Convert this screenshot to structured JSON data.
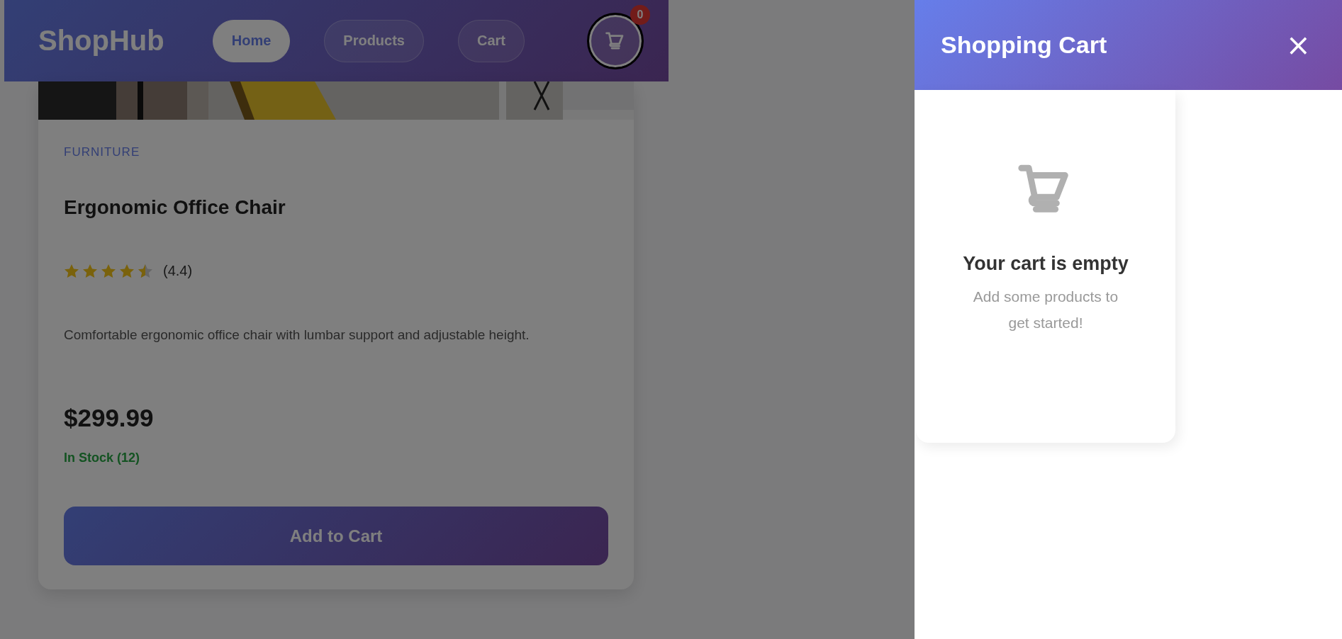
{
  "header": {
    "logo": "ShopHub",
    "nav": [
      {
        "label": "Home",
        "selected": true
      },
      {
        "label": "Products",
        "selected": false
      },
      {
        "label": "Cart",
        "selected": false
      }
    ],
    "cart_count": "0"
  },
  "product": {
    "category": "FURNITURE",
    "name": "Ergonomic Office Chair",
    "stars": 4.5,
    "rating": "(4.4)",
    "description": "Comfortable ergonomic office chair with lumbar support and adjustable height.",
    "price": "$299.99",
    "stock": "In Stock (12)",
    "in_stock": true,
    "button": "Add to Cart"
  },
  "cart_panel": {
    "title": "Shopping Cart",
    "close": "×",
    "empty_title": "Your cart is empty",
    "empty_text": "Add some products to get started!"
  }
}
